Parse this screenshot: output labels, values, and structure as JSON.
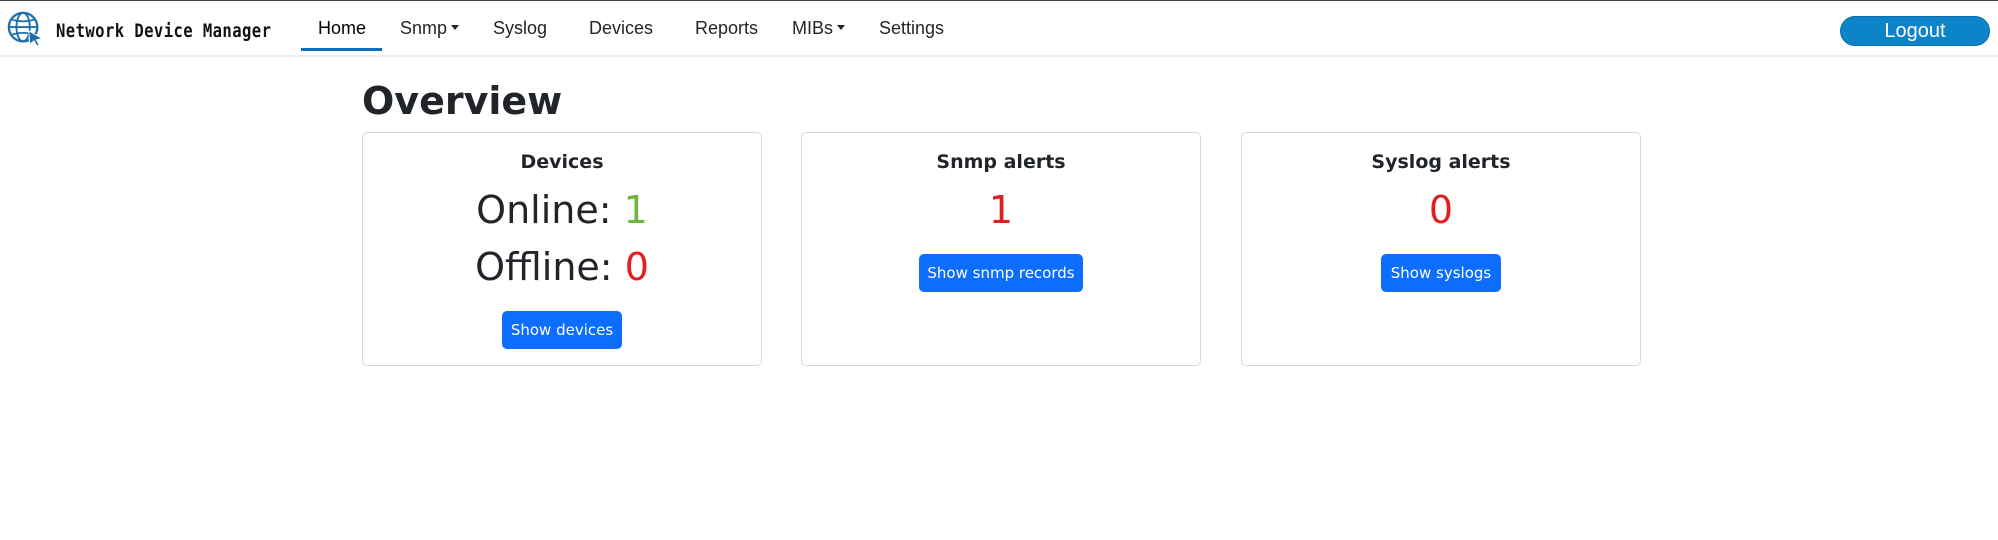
{
  "app": {
    "title": "Network Device Manager"
  },
  "nav": {
    "home": "Home",
    "snmp": "Snmp",
    "syslog": "Syslog",
    "devices": "Devices",
    "reports": "Reports",
    "mibs": "MIBs",
    "settings": "Settings",
    "logout": "Logout"
  },
  "page": {
    "title": "Overview"
  },
  "cards": {
    "devices": {
      "title": "Devices",
      "online_label": "Online: ",
      "online_value": "1",
      "offline_label": "Offline: ",
      "offline_value": "0",
      "button": "Show devices"
    },
    "snmp": {
      "title": "Snmp alerts",
      "value": "1",
      "button": "Show snmp records"
    },
    "syslog": {
      "title": "Syslog alerts",
      "value": "0",
      "button": "Show syslogs"
    }
  },
  "colors": {
    "primary": "#0d6efd",
    "logout": "#0d84c9",
    "online": "#6cb73b",
    "alert": "#e31e1e",
    "active_tab": "#0e6eb8"
  },
  "icons": {
    "brand": "globe-cursor-icon",
    "dropdown": "caret-down-icon"
  }
}
